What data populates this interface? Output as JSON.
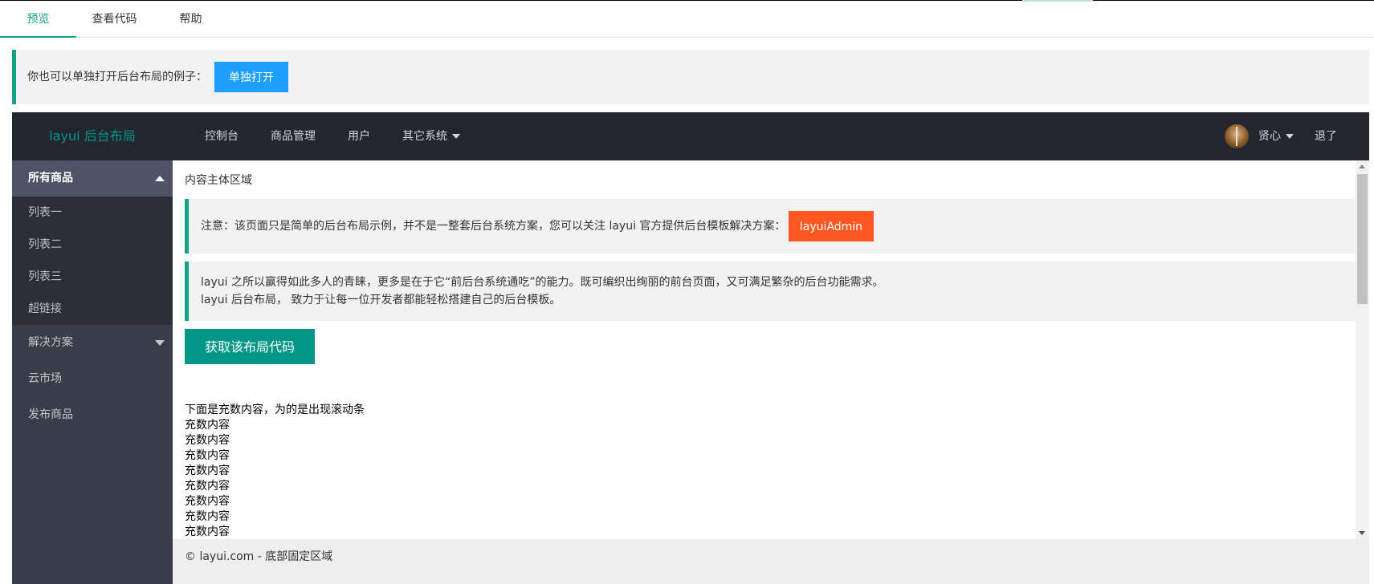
{
  "tabs": [
    {
      "label": "预览",
      "active": true
    },
    {
      "label": "查看代码",
      "active": false
    },
    {
      "label": "帮助",
      "active": false
    }
  ],
  "notice": {
    "text": "你也可以单独打开后台布局的例子：",
    "button_label": "单独打开"
  },
  "header": {
    "logo": "layui 后台布局",
    "nav": [
      "控制台",
      "商品管理",
      "用户",
      "其它系统"
    ],
    "user_name": "贤心",
    "logout": "退了"
  },
  "sidebar": {
    "groups": [
      {
        "label": "所有商品",
        "open": true,
        "children": [
          "列表一",
          "列表二",
          "列表三",
          "超链接"
        ]
      },
      {
        "label": "解决方案",
        "open": false
      },
      {
        "label": "云市场"
      },
      {
        "label": "发布商品"
      }
    ]
  },
  "content": {
    "title": "内容主体区域",
    "note_text": "注意：该页面只是简单的后台布局示例，并不是一整套后台系统方案，您可以关注 layui 官方提供后台模板解决方案：",
    "note_button": "layuiAdmin",
    "desc_line1": "layui 之所以赢得如此多人的青睐，更多是在于它“前后台系统通吃”的能力。既可编织出绚丽的前台页面，又可满足繁杂的后台功能需求。",
    "desc_line2": "layui 后台布局， 致力于让每一位开发者都能轻松搭建自己的后台模板。",
    "get_code_button": "获取该布局代码",
    "filler_intro": "下面是充数内容，为的是出现滚动条",
    "filler_line": "充数内容"
  },
  "footer": {
    "text": "© layui.com - 底部固定区域"
  },
  "colors": {
    "accent_green": "#16a085",
    "header_bg": "#23262e",
    "sidebar_bg": "#393d49",
    "blue_button": "#1e9fff",
    "orange_button": "#ff5722",
    "teal_button": "#009688"
  }
}
